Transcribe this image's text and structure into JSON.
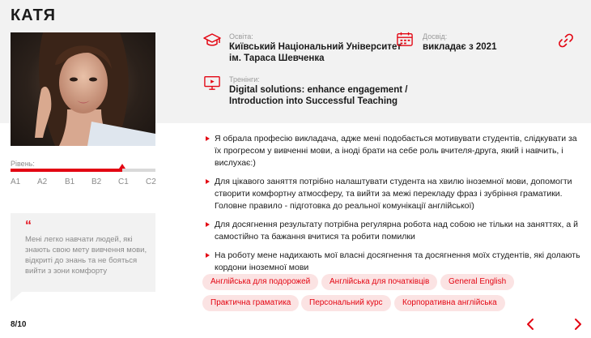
{
  "profile": {
    "name": "КАТЯ",
    "photo_alt": "teacher portrait"
  },
  "level": {
    "label": "Рівень:",
    "ticks": [
      "A1",
      "A2",
      "B1",
      "B2",
      "C1",
      "C2"
    ],
    "current": "C1",
    "progress_fraction": 0.77
  },
  "quote": {
    "mark": "“",
    "text": "Мені легко навчати людей, які знають свою мету вивчення мови, відкриті до знань та не бояться вийти з зони комфорту"
  },
  "education": {
    "label": "Освіта:",
    "value_line1": "Київський Національний Університет",
    "value_line2": "ім. Тараса Шевченка"
  },
  "experience": {
    "label": "Досвід:",
    "value": "викладає з 2021"
  },
  "trainings": {
    "label": "Тренінги:",
    "value_line1": "Digital solutions: enhance engagement /",
    "value_line2": "Introduction into Successful Teaching"
  },
  "bullets": [
    "Я обрала професію викладача, адже мені подобається мотивувати студентів, слідкувати за їх прогресом у вивченні мови, а іноді брати на себе роль вчителя-друга, який і навчить, і вислухає:)",
    "Для цікавого заняття потрібно налаштувати студента на хвилю іноземної мови, допомогти створити комфортну атмосферу, та вийти за межі перекладу фраз і зубріння граматики. Головне правило - підготовка до реальної комунікації англійської)",
    "Для досягнення результату потрібна регулярна робота над собою не тільки на заняттях, а й самостійно та бажання вчитися та робити помилки",
    "На роботу мене надихають мої власні досягнення та досягнення моїх студентів, які долають кордони іноземної мови"
  ],
  "tags": [
    "Англійська для подорожей",
    "Англійська для початківців",
    "General English",
    "Практична граматика",
    "Персональний курс",
    "Корпоративна англійська"
  ],
  "pager": {
    "text": "8/10"
  },
  "icons": {
    "education": "graduation-cap-icon",
    "experience": "calendar-icon",
    "trainings": "presentation-monitor-icon",
    "link": "chain-link-icon",
    "prev": "chevron-left-icon",
    "next": "chevron-right-icon"
  },
  "colors": {
    "accent": "#e30613",
    "tag_bg": "#fbe3e3",
    "band_bg": "#f2f2f2",
    "muted_text": "#8a8a8a"
  }
}
